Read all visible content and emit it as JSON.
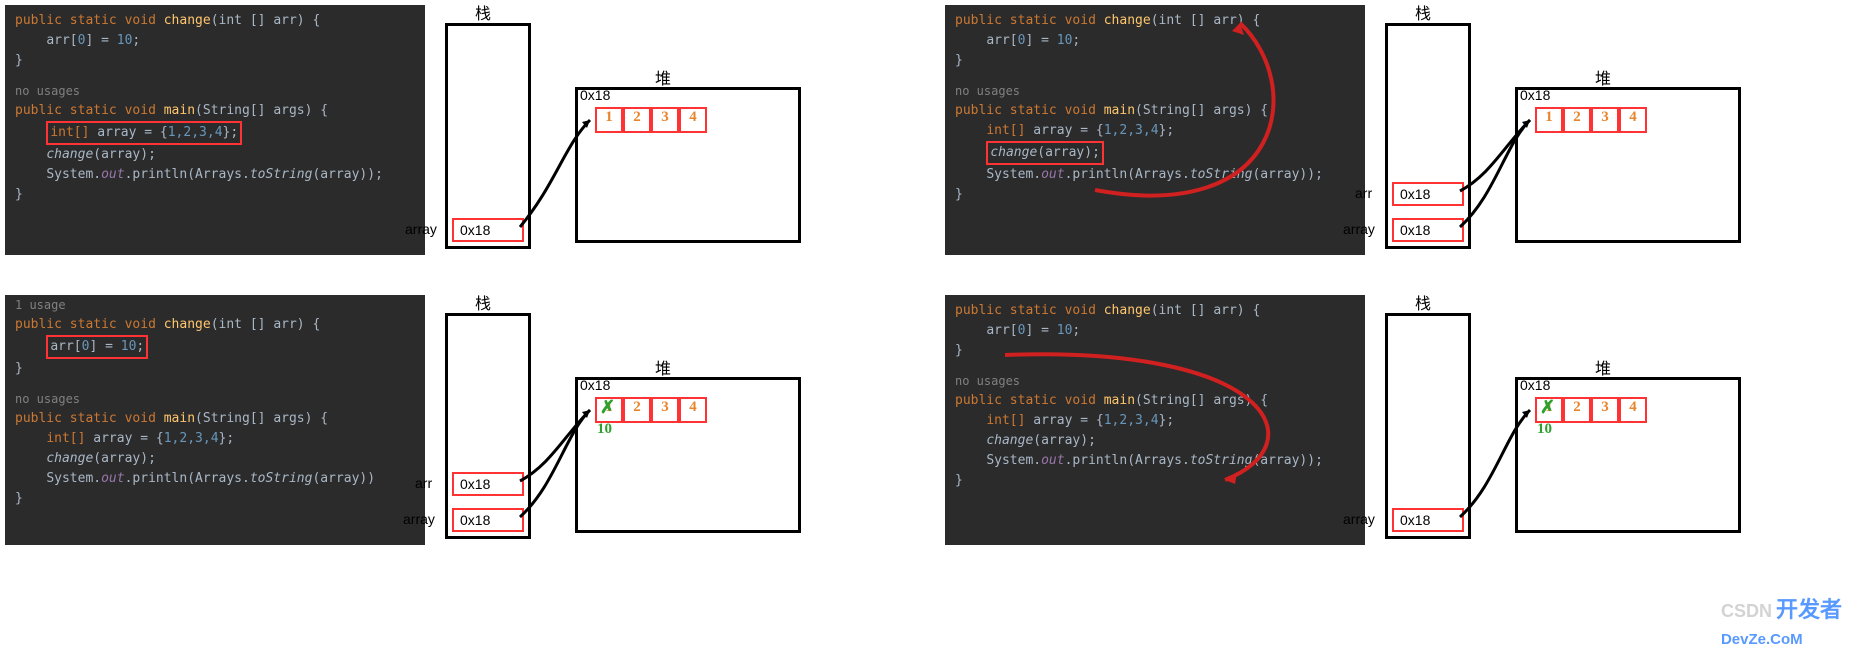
{
  "labels": {
    "stack": "栈",
    "heap": "堆",
    "no_usages": "no usages",
    "one_usage": "1 usage"
  },
  "vars": {
    "array": "array",
    "arr": "arr"
  },
  "addr": "0x18",
  "heap_values": [
    "1",
    "2",
    "3",
    "4"
  ],
  "new_value": "10",
  "code": {
    "line1_public": "public",
    "line1_static": "static",
    "line1_void": "void",
    "change_name": "change",
    "change_params": "(int [] arr) {",
    "change_body": "arr[0] = 10;",
    "change_body_pre": "arr[",
    "change_body_idx": "0",
    "change_body_mid": "] = ",
    "change_body_val": "10",
    "change_body_end": ";",
    "brace": "}",
    "main_name": "main",
    "main_params": "(String[] args) {",
    "array_decl_type": "int[]",
    "array_decl_name": " array = {",
    "array_decl_vals": "1,2,3,4",
    "array_decl_end": "};",
    "call_change": "change",
    "call_change_arg": "(array);",
    "println_sys": "System.",
    "println_out": "out",
    "println_print": ".println(Arrays.",
    "println_tostr": "toString",
    "println_end": "(array));",
    "println_end_noSemi": "(array))"
  },
  "watermark": {
    "csdn": "CSDN",
    "text1": "开发者",
    "text2": "DevZe.CoM"
  }
}
